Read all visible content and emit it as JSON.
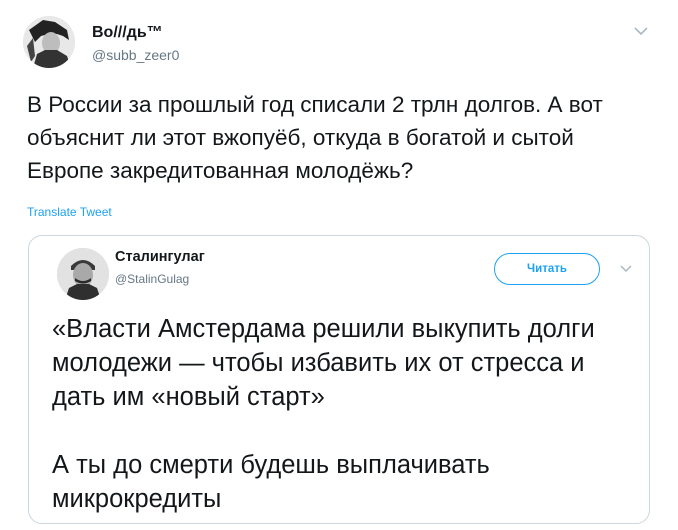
{
  "tweet": {
    "author_name": "Во///дь™",
    "author_handle": "@subb_zeer0",
    "text": "В России за прошлый год списали 2 трлн долгов. А вот объяснит ли этот вжопуёб, откуда в богатой и сытой Европе закредитованная молодёжь?",
    "translate_label": "Translate Tweet",
    "caret_icon": "chevron-down-icon",
    "avatar_icon": "avatar"
  },
  "quoted_tweet": {
    "author_name": "Сталингулаг",
    "author_handle": "@StalinGulag",
    "follow_label": "Читать",
    "paragraph_1": "«Власти Амстердама решили выкупить долги молодежи — чтобы избавить их от стресса и дать им «новый старт»",
    "paragraph_2": "А ты до смерти будешь выплачивать микрокредиты",
    "caret_icon": "chevron-down-icon",
    "avatar_icon": "avatar"
  },
  "colors": {
    "accent": "#1da1f2",
    "secondary_text": "#657786",
    "border": "#ccd6dd"
  }
}
